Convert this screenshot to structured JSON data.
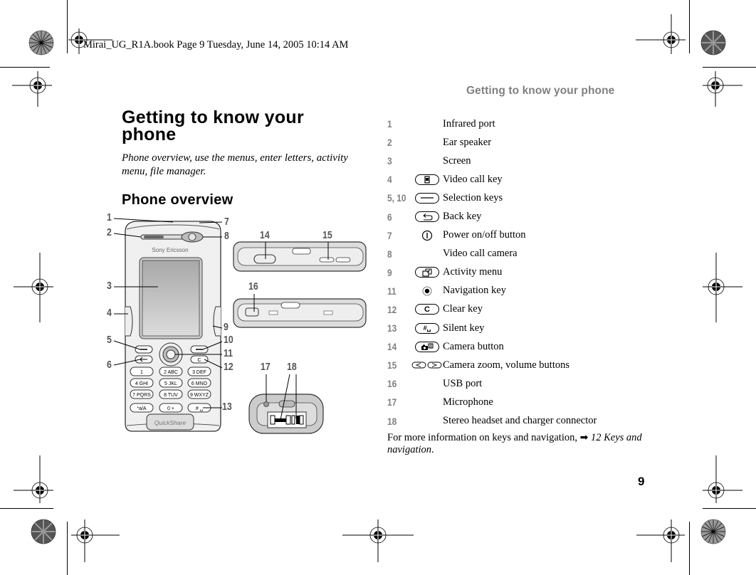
{
  "book_header": "Mirai_UG_R1A.book  Page 9  Tuesday, June 14, 2005  10:14 AM",
  "running_head": "Getting to know your phone",
  "page_title": "Getting to know your phone",
  "intro": "Phone overview, use the menus, enter letters, activity menu, file manager.",
  "section_title": "Phone overview",
  "illustration": {
    "brand": "Sony Ericsson",
    "quickshare": "QuickShare",
    "keypad": [
      "1",
      "2 ABC",
      "3 DEF",
      "4 GHI",
      "5 JKL",
      "6 MNO",
      "7 PQRS",
      "8 TUV",
      "9 WXYZ",
      "*a/A",
      "0 +",
      "# ␣"
    ],
    "callouts": [
      "1",
      "2",
      "3",
      "4",
      "5",
      "6",
      "7",
      "8",
      "9",
      "10",
      "11",
      "12",
      "13",
      "14",
      "15",
      "16",
      "17",
      "18"
    ]
  },
  "legend": [
    {
      "num": "1",
      "icon": "none",
      "text": "Infrared port"
    },
    {
      "num": "2",
      "icon": "none",
      "text": "Ear speaker"
    },
    {
      "num": "3",
      "icon": "none",
      "text": "Screen"
    },
    {
      "num": "4",
      "icon": "video-call-key-icon",
      "text": "Video call key"
    },
    {
      "num": "5, 10",
      "icon": "selection-key-icon",
      "text": "Selection keys"
    },
    {
      "num": "6",
      "icon": "back-key-icon",
      "text": "Back key"
    },
    {
      "num": "7",
      "icon": "power-icon",
      "text": "Power on/off button"
    },
    {
      "num": "8",
      "icon": "none",
      "text": "Video call camera"
    },
    {
      "num": "9",
      "icon": "activity-menu-icon",
      "text": "Activity menu"
    },
    {
      "num": "11",
      "icon": "navigation-key-icon",
      "text": "Navigation key"
    },
    {
      "num": "12",
      "icon": "clear-key-icon",
      "text": "Clear key"
    },
    {
      "num": "13",
      "icon": "silent-key-icon",
      "text": "Silent key"
    },
    {
      "num": "14",
      "icon": "camera-button-icon",
      "text": "Camera button"
    },
    {
      "num": "15",
      "icon": "zoom-volume-icon",
      "text": "Camera zoom, volume buttons"
    },
    {
      "num": "16",
      "icon": "none",
      "text": "USB port"
    },
    {
      "num": "17",
      "icon": "none",
      "text": "Microphone"
    },
    {
      "num": "18",
      "icon": "none",
      "text": "Stereo headset and charger connector"
    }
  ],
  "key_glyphs": {
    "clear": "C",
    "silent": "#␣"
  },
  "footer_note": {
    "text": "For more information on keys and navigation, ",
    "arrow": "➡",
    "ref": "12 Keys and navigation",
    "end": "."
  },
  "page_number": "9"
}
